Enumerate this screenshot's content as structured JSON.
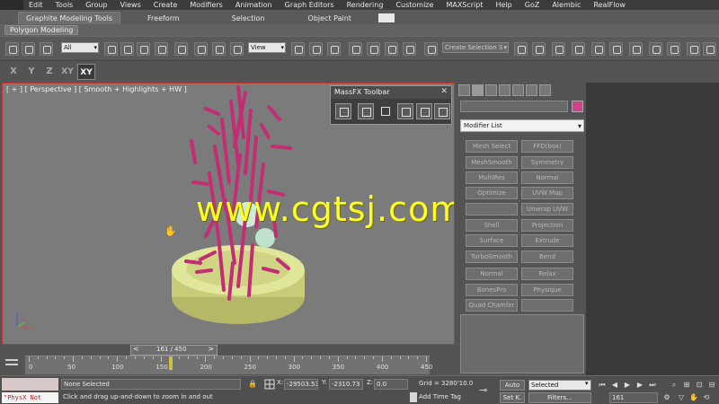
{
  "menu": [
    "Edit",
    "Tools",
    "Group",
    "Views",
    "Create",
    "Modifiers",
    "Animation",
    "Graph Editors",
    "Rendering",
    "Customize",
    "MAXScript",
    "Help",
    "GoZ",
    "Alembic",
    "RealFlow"
  ],
  "ribbon": {
    "tabs": [
      "Graphite Modeling Tools",
      "Freeform",
      "Selection",
      "Object Paint"
    ],
    "active_panel": "Polygon Modeling"
  },
  "toolbar": {
    "filter_value": "All",
    "reference_coord": "View",
    "selection_set_placeholder": "Create Selection S"
  },
  "axis_constraints": [
    "X",
    "Y",
    "Z",
    "XY",
    "XY"
  ],
  "viewport": {
    "label": "[ + ] [ Perspective ] [ Smooth + Highlights + HW ]",
    "watermark": "www.cgtsj.com"
  },
  "massfx": {
    "title": "MassFX Toolbar"
  },
  "command_panel": {
    "modifier_list": "Modifier List",
    "modifiers_left": [
      "Mesh Select",
      "MeshSmooth",
      "MultiRes",
      "Optimize",
      "Shell",
      "Surface",
      "TurboSmooth",
      "Normal",
      "BonesPro",
      "Quad Chamfer"
    ],
    "modifiers_right": [
      "FFD(box)",
      "Symmetry",
      "Normal",
      "UVW Map",
      "Unwrap UVW",
      "Projection",
      "Extrude",
      "Bend",
      "Relax",
      "Physique"
    ],
    "object_color": "#d2428b"
  },
  "timeline": {
    "frame_display": "161 / 450",
    "current_frame": 161,
    "total_frames": 450,
    "tick_labels": [
      "0",
      "50",
      "100",
      "150",
      "200",
      "250",
      "300",
      "350",
      "400",
      "450"
    ]
  },
  "status": {
    "maxscript_text": "\"PhysX Not",
    "selection": "None Selected",
    "prompt": "Click and drag up-and-down to zoom in and out",
    "x_label": "X:",
    "x_value": "-29503.53",
    "y_label": "Y:",
    "y_value": "-2310.73",
    "z_label": "Z:",
    "z_value": "0.0",
    "grid": "Grid = 3280'10.079\"",
    "add_time_tag": "Add Time Tag",
    "auto_label": "Auto",
    "setkey_label": "Set K.",
    "selected_dropdown": "Selected",
    "filters_label": "Filters...",
    "frame_field": "161"
  }
}
